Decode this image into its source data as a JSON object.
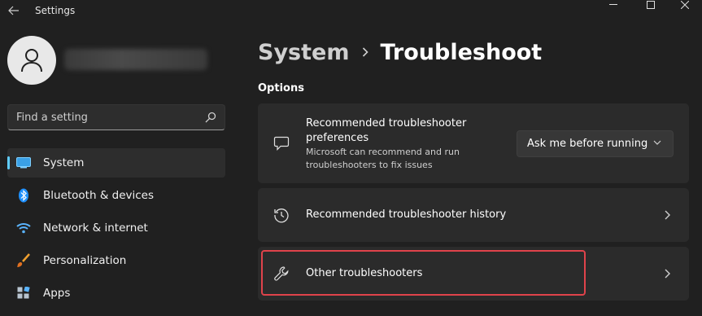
{
  "app": {
    "title": "Settings"
  },
  "user": {
    "avatar_icon": "person-icon"
  },
  "search": {
    "placeholder": "Find a setting"
  },
  "sidebar": {
    "items": [
      {
        "label": "System",
        "icon": "system-icon",
        "active": true
      },
      {
        "label": "Bluetooth & devices",
        "icon": "bluetooth-icon"
      },
      {
        "label": "Network & internet",
        "icon": "wifi-icon"
      },
      {
        "label": "Personalization",
        "icon": "brush-icon"
      },
      {
        "label": "Apps",
        "icon": "apps-icon"
      }
    ]
  },
  "breadcrumb": {
    "parent": "System",
    "current": "Troubleshoot"
  },
  "main": {
    "section_label": "Options",
    "cards": [
      {
        "title": "Recommended troubleshooter preferences",
        "description": "Microsoft can recommend and run troubleshooters to fix issues",
        "icon": "chat-bubble-icon",
        "dropdown_value": "Ask me before running"
      },
      {
        "title": "Recommended troubleshooter history",
        "icon": "history-icon"
      },
      {
        "title": "Other troubleshooters",
        "icon": "wrench-icon",
        "highlighted": true
      }
    ]
  },
  "colors": {
    "background": "#202020",
    "card": "#2b2b2b",
    "accent": "#60cdff",
    "highlight": "#e0434b"
  }
}
